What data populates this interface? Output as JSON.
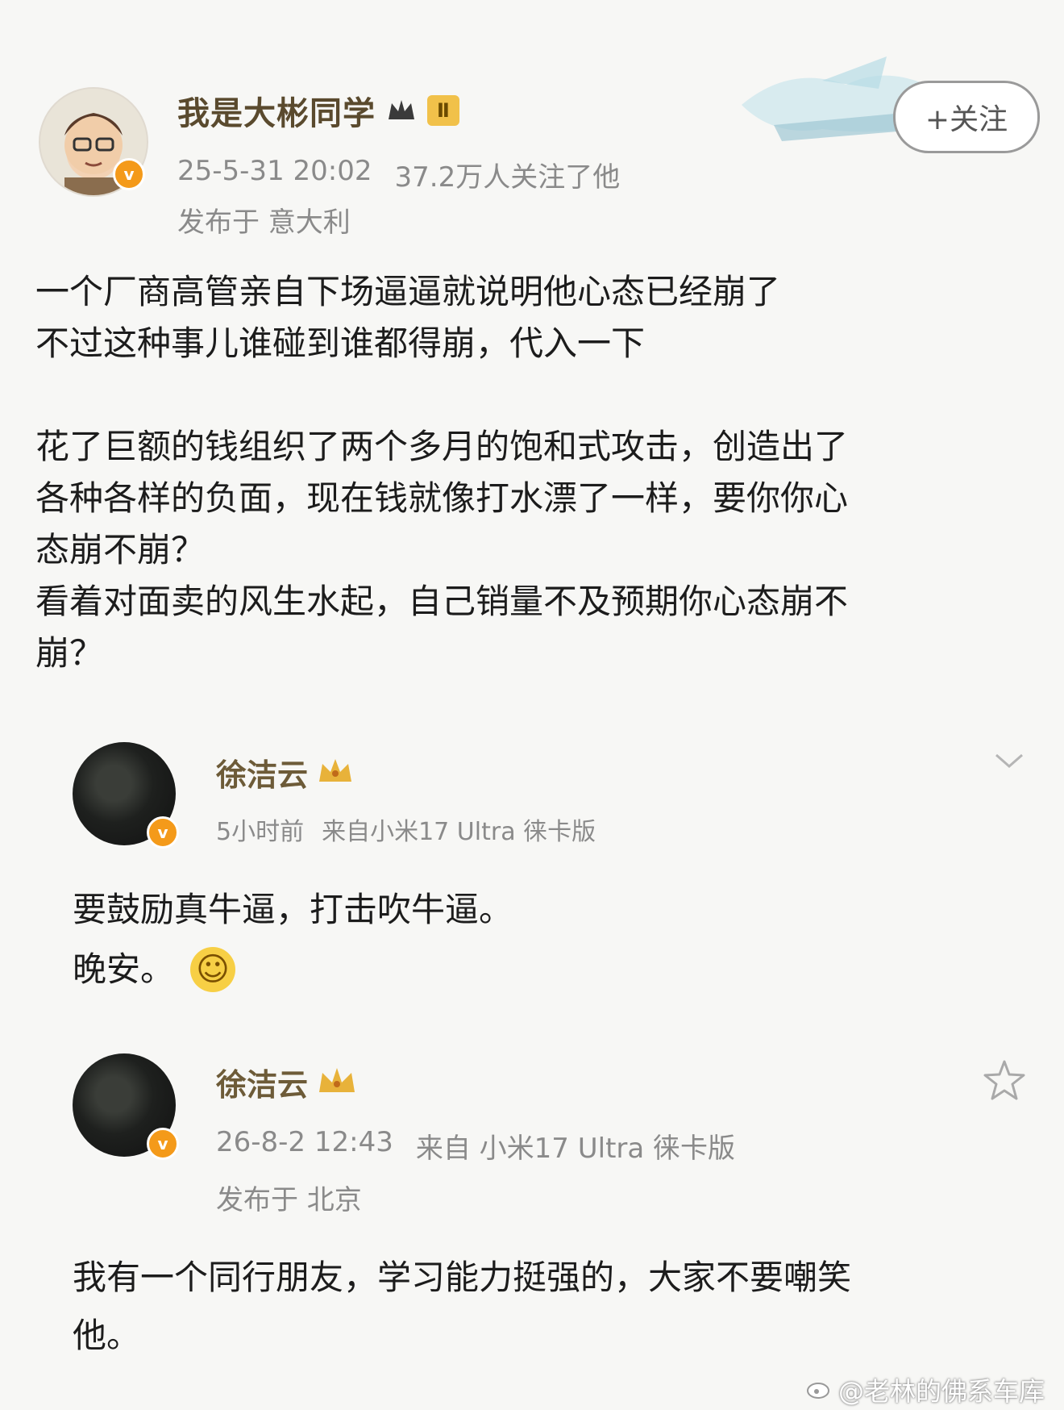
{
  "post": {
    "author": "我是大彬同学",
    "level_badge": "Ⅱ",
    "date": "25-5-31 20:02",
    "followers": "37.2万人关注了他",
    "location": "发布于 意大利",
    "follow_label": "+关注",
    "lines": [
      "一个厂商高管亲自下场逼逼就说明他心态已经崩了",
      "不过这种事儿谁碰到谁都得崩，代入一下",
      "花了巨额的钱组织了两个多月的饱和式攻击，创造出了",
      "各种各样的负面，现在钱就像打水漂了一样，要你你心",
      "态崩不崩？",
      "看着对面卖的风生水起，自己销量不及预期你心态崩不",
      "崩？"
    ]
  },
  "reply1": {
    "author": "徐洁云",
    "time": "5小时前",
    "source": "来自小米17 Ultra 徕卡版",
    "lines": [
      "要鼓励真牛逼，打击吹牛逼。",
      "晚安。"
    ],
    "emoji": "☺"
  },
  "reply2": {
    "author": "徐洁云",
    "date": "26-8-2 12:43",
    "source": "来自 小米17 Ultra 徕卡版",
    "location": "发布于 北京",
    "lines": [
      "我有一个同行朋友，学习能力挺强的，大家不要嘲笑",
      "他。"
    ]
  },
  "watermark": "@老林的佛系车库",
  "verified_mark": "v",
  "icons": [
    "chevron-down-icon",
    "star-icon",
    "crown-icon",
    "smile-emoji",
    "weibo-logo"
  ],
  "colors": {
    "verified": "#f49a1a",
    "username": "#6d5b38",
    "meta": "#8a8a8a"
  }
}
